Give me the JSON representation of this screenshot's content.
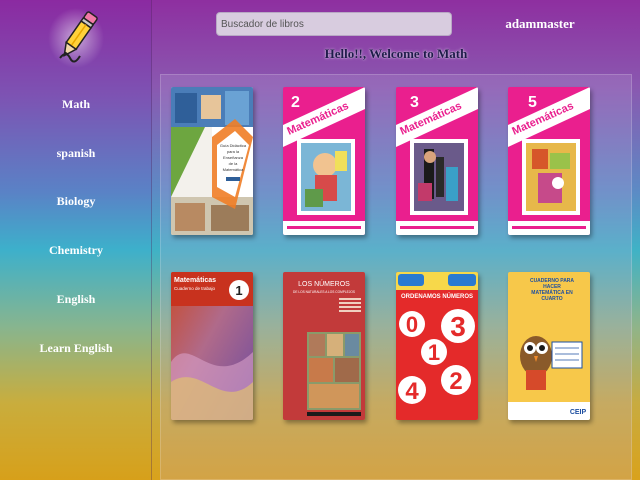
{
  "sidebar": {
    "logo_icon": "pencil-icon",
    "items": [
      {
        "label": "Math"
      },
      {
        "label": "spanish"
      },
      {
        "label": "Biology"
      },
      {
        "label": "Chemistry"
      },
      {
        "label": "English"
      },
      {
        "label": "Learn English"
      }
    ]
  },
  "header": {
    "search_placeholder": "Buscador de libros",
    "username": "adammaster",
    "welcome": "Hello!!, Welcome to Math"
  },
  "books": [
    {
      "cover_title": "Guía Didáctica para la Enseñanza de la Matemática"
    },
    {
      "cover_grade": "2",
      "cover_title": "Matemáticas"
    },
    {
      "cover_grade": "3",
      "cover_title": "Matemáticas"
    },
    {
      "cover_grade": "5",
      "cover_title": "Matemáticas"
    },
    {
      "cover_title": "Matemáticas",
      "cover_subtitle": "Cuaderno de trabajo",
      "cover_grade": "1"
    },
    {
      "cover_title": "LOS NÚMEROS",
      "cover_subtitle": "DE LOS NATURALES A LOS COMPLEJOS"
    },
    {
      "cover_title": "ORDENAMOS NÚMEROS",
      "digits": [
        "0",
        "1",
        "3",
        "4",
        "2"
      ]
    },
    {
      "cover_title": "CUADERNO PARA HACER MATEMÁTICA EN CUARTO",
      "cover_brand": "CEIP"
    }
  ],
  "colors": {
    "accent": "#ea1f8e",
    "sidebar_text": "#ffffff",
    "welcome_text": "#1f1a4a"
  }
}
